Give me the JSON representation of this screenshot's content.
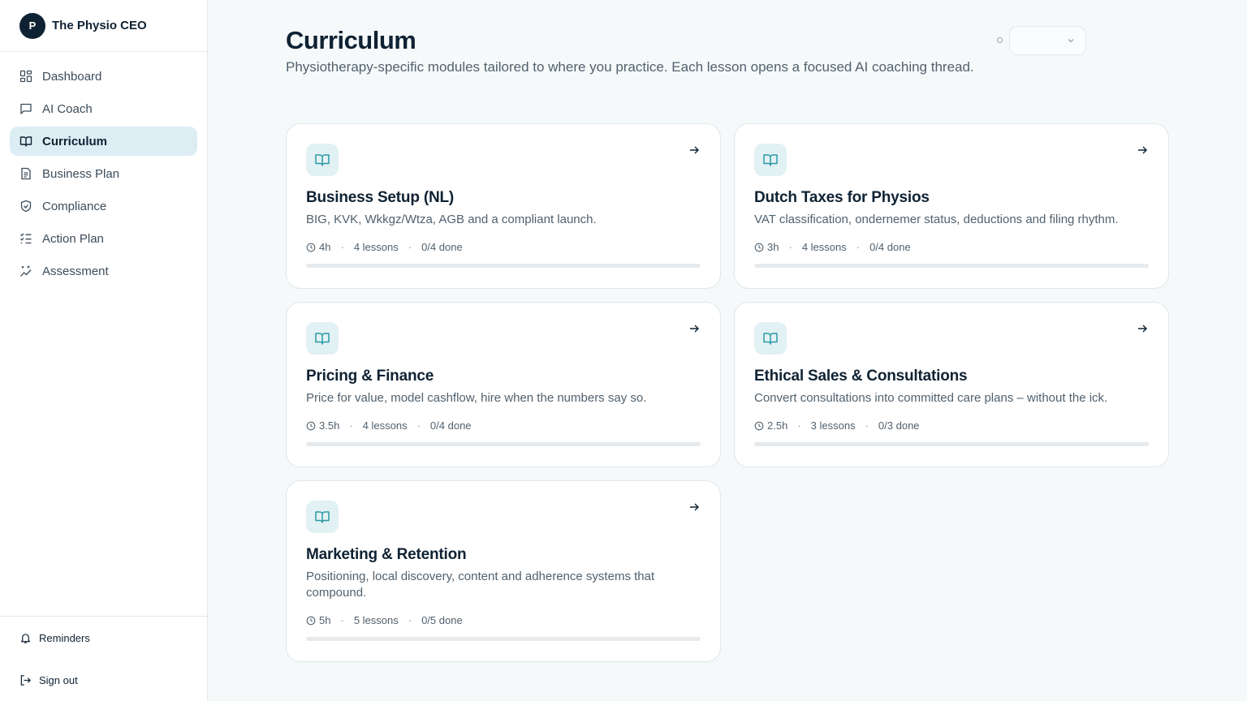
{
  "brand": {
    "initial": "P",
    "name": "The Physio CEO"
  },
  "sidebar": {
    "items": [
      {
        "label": "Dashboard",
        "icon": "dashboard-icon",
        "active": false
      },
      {
        "label": "AI Coach",
        "icon": "chat-icon",
        "active": false
      },
      {
        "label": "Curriculum",
        "icon": "book-icon",
        "active": true
      },
      {
        "label": "Business Plan",
        "icon": "document-icon",
        "active": false
      },
      {
        "label": "Compliance",
        "icon": "shield-icon",
        "active": false
      },
      {
        "label": "Action Plan",
        "icon": "checklist-icon",
        "active": false
      },
      {
        "label": "Assessment",
        "icon": "sparkle-chart-icon",
        "active": false
      }
    ],
    "footer": {
      "reminders": "Reminders",
      "sign_out": "Sign out"
    }
  },
  "header": {
    "title": "Curriculum",
    "subtitle": "Physiotherapy-specific modules tailored to where you practice. Each lesson opens a focused AI coaching thread."
  },
  "modules": [
    {
      "title": "Business Setup (NL)",
      "description": "BIG, KVK, Wkkgz/Wtza, AGB and a compliant launch.",
      "hours": "4h",
      "lessons": "4 lessons",
      "done": "0/4 done",
      "progress": 0
    },
    {
      "title": "Dutch Taxes for Physios",
      "description": "VAT classification, ondernemer status, deductions and filing rhythm.",
      "hours": "3h",
      "lessons": "4 lessons",
      "done": "0/4 done",
      "progress": 0
    },
    {
      "title": "Pricing & Finance",
      "description": "Price for value, model cashflow, hire when the numbers say so.",
      "hours": "3.5h",
      "lessons": "4 lessons",
      "done": "0/4 done",
      "progress": 0
    },
    {
      "title": "Ethical Sales & Consultations",
      "description": "Convert consultations into committed care plans – without the ick.",
      "hours": "2.5h",
      "lessons": "3 lessons",
      "done": "0/3 done",
      "progress": 0
    },
    {
      "title": "Marketing & Retention",
      "description": "Positioning, local discovery, content and adherence systems that compound.",
      "hours": "5h",
      "lessons": "5 lessons",
      "done": "0/5 done",
      "progress": 0
    }
  ],
  "colors": {
    "accent": "#2a9aa6",
    "active_bg": "#dcedf4",
    "text": "#0f2233"
  }
}
